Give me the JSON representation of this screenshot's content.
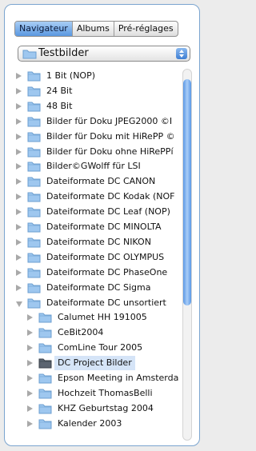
{
  "tabs": [
    {
      "label": "Navigateur",
      "active": true
    },
    {
      "label": "Albums",
      "active": false
    },
    {
      "label": "Pré-réglages",
      "active": false
    }
  ],
  "location": {
    "label": "Testbilder",
    "icon": "folder-icon"
  },
  "tree": [
    {
      "label": "1 Bit (NOP)",
      "level": 0,
      "state": "closed"
    },
    {
      "label": "24 Bit",
      "level": 0,
      "state": "closed"
    },
    {
      "label": "48 Bit",
      "level": 0,
      "state": "closed"
    },
    {
      "label": "Bilder für Doku JPEG2000  ©I",
      "level": 0,
      "state": "closed"
    },
    {
      "label": "Bilder für Doku mit HiRePP ©",
      "level": 0,
      "state": "closed"
    },
    {
      "label": "Bilder für Doku ohne HiRePPí",
      "level": 0,
      "state": "closed"
    },
    {
      "label": "Bilder©GWolff für LSI",
      "level": 0,
      "state": "closed"
    },
    {
      "label": "Dateiformate DC CANON",
      "level": 0,
      "state": "closed"
    },
    {
      "label": "Dateiformate DC Kodak (NOF",
      "level": 0,
      "state": "closed"
    },
    {
      "label": "Dateiformate DC Leaf (NOP)",
      "level": 0,
      "state": "closed"
    },
    {
      "label": "Dateiformate DC MINOLTA",
      "level": 0,
      "state": "closed"
    },
    {
      "label": "Dateiformate DC NIKON",
      "level": 0,
      "state": "closed"
    },
    {
      "label": "Dateiformate DC OLYMPUS",
      "level": 0,
      "state": "closed"
    },
    {
      "label": "Dateiformate DC PhaseOne",
      "level": 0,
      "state": "closed"
    },
    {
      "label": "Dateiformate DC Sigma",
      "level": 0,
      "state": "closed"
    },
    {
      "label": "Dateiformate DC unsortiert",
      "level": 0,
      "state": "open"
    },
    {
      "label": "Calumet HH 191005",
      "level": 1,
      "state": "closed"
    },
    {
      "label": "CeBit2004",
      "level": 1,
      "state": "closed"
    },
    {
      "label": "ComLine Tour 2005",
      "level": 1,
      "state": "closed"
    },
    {
      "label": "DC Project Bilder",
      "level": 1,
      "state": "closed",
      "selected": true,
      "dark": true
    },
    {
      "label": "Epson Meeting in Amsterda",
      "level": 1,
      "state": "closed"
    },
    {
      "label": "Hochzeit ThomasBelli",
      "level": 1,
      "state": "closed"
    },
    {
      "label": "KHZ Geburtstag 2004",
      "level": 1,
      "state": "closed"
    },
    {
      "label": "Kalender 2003",
      "level": 1,
      "state": "closed"
    }
  ],
  "colors": {
    "accent": "#5a97e0",
    "selection": "#d5e4f7",
    "folder": "#9ec7ef",
    "border": "#7aa4cf"
  }
}
